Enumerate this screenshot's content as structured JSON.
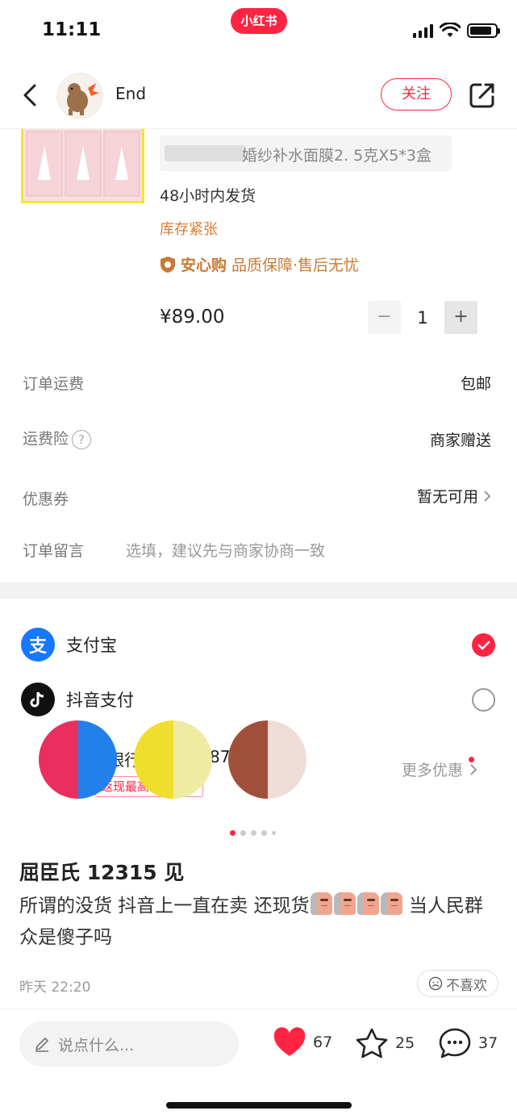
{
  "status_bar": {
    "time": "11:11",
    "brand": "小红书"
  },
  "header": {
    "back_icon": "chevron-left-icon",
    "author_name": "End",
    "follow_label": "关注",
    "share_icon": "share-icon"
  },
  "product": {
    "title": "婚纱补水面膜2. 5克X5*3盒",
    "ship_time": "48小时内发货",
    "stock_tag": "库存紧张",
    "guarantee_brand": "安心购",
    "guarantee_text": "品质保障·售后无忧",
    "price": "¥89.00",
    "quantity": "1",
    "minus_label": "−",
    "plus_label": "+"
  },
  "order": {
    "shipping_label": "订单运费",
    "shipping_value": "包邮",
    "insurance_label": "运费险",
    "insurance_help": "?",
    "insurance_value": "商家赠送",
    "coupon_label": "优惠券",
    "coupon_value": "暂无可用",
    "remark_label": "订单留言",
    "remark_placeholder": "选填，建议先与商家协商一致"
  },
  "payment": {
    "alipay_label": "支付宝",
    "alipay_icon_char": "支",
    "douyin_label": "抖音支付",
    "bank_partial": "银行",
    "bank_number_partial": "87",
    "cashback_partial": "返现最高",
    "more_offers": "更多优惠"
  },
  "swatches": [
    {
      "left": "#ea2f5f",
      "right": "#2280ea"
    },
    {
      "left": "#f0de2c",
      "right": "#f0eba2"
    },
    {
      "left": "#a0503a",
      "right": "#f0dcd6"
    }
  ],
  "note": {
    "title": "屈臣氏 12315 见",
    "body_part1": "所谓的没货 抖音上一直在卖 还现货",
    "body_part2": " 当人民群众是傻子吗",
    "date": "昨天 22:20",
    "dislike_label": "不喜欢"
  },
  "bottom_bar": {
    "comment_placeholder": "说点什么...",
    "likes": "67",
    "collects": "25",
    "comments": "37"
  },
  "colors": {
    "brand_red": "#ff2442",
    "guarantee_orange": "#c87a34",
    "alipay_blue": "#1677ff"
  }
}
